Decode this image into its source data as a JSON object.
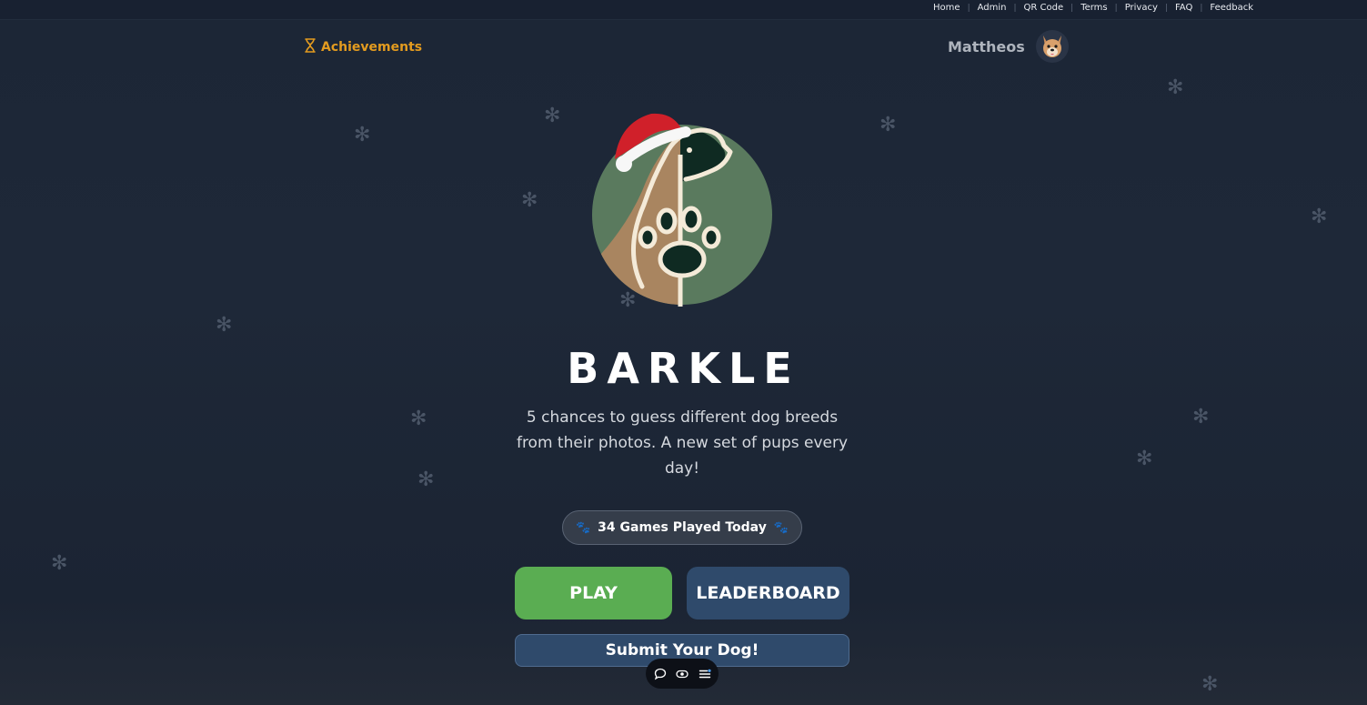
{
  "topnav": {
    "links": [
      "Home",
      "Admin",
      "QR Code",
      "Terms",
      "Privacy",
      "FAQ",
      "Feedback"
    ]
  },
  "header": {
    "achievements_label": "Achievements",
    "username": "Mattheos"
  },
  "main": {
    "title": "BARKLE",
    "description": "5 chances to guess different dog breeds from their photos. A new set of pups every day!",
    "games_played": "34 Games Played Today",
    "play_label": "PLAY",
    "leaderboard_label": "LEADERBOARD",
    "submit_label": "Submit Your Dog!"
  },
  "icons": {
    "achievements": "hourglass-icon",
    "avatar": "dog-avatar-icon",
    "logo": "dog-paw-logo-santa-hat",
    "pill": "paw-icon",
    "toolbar": [
      "chat-icon",
      "eye-icon",
      "menu-icon"
    ]
  },
  "colors": {
    "accent_orange": "#e39b1f",
    "play_green": "#5aad52",
    "secondary_blue": "#2f4a6b",
    "background": "#1e2838"
  }
}
